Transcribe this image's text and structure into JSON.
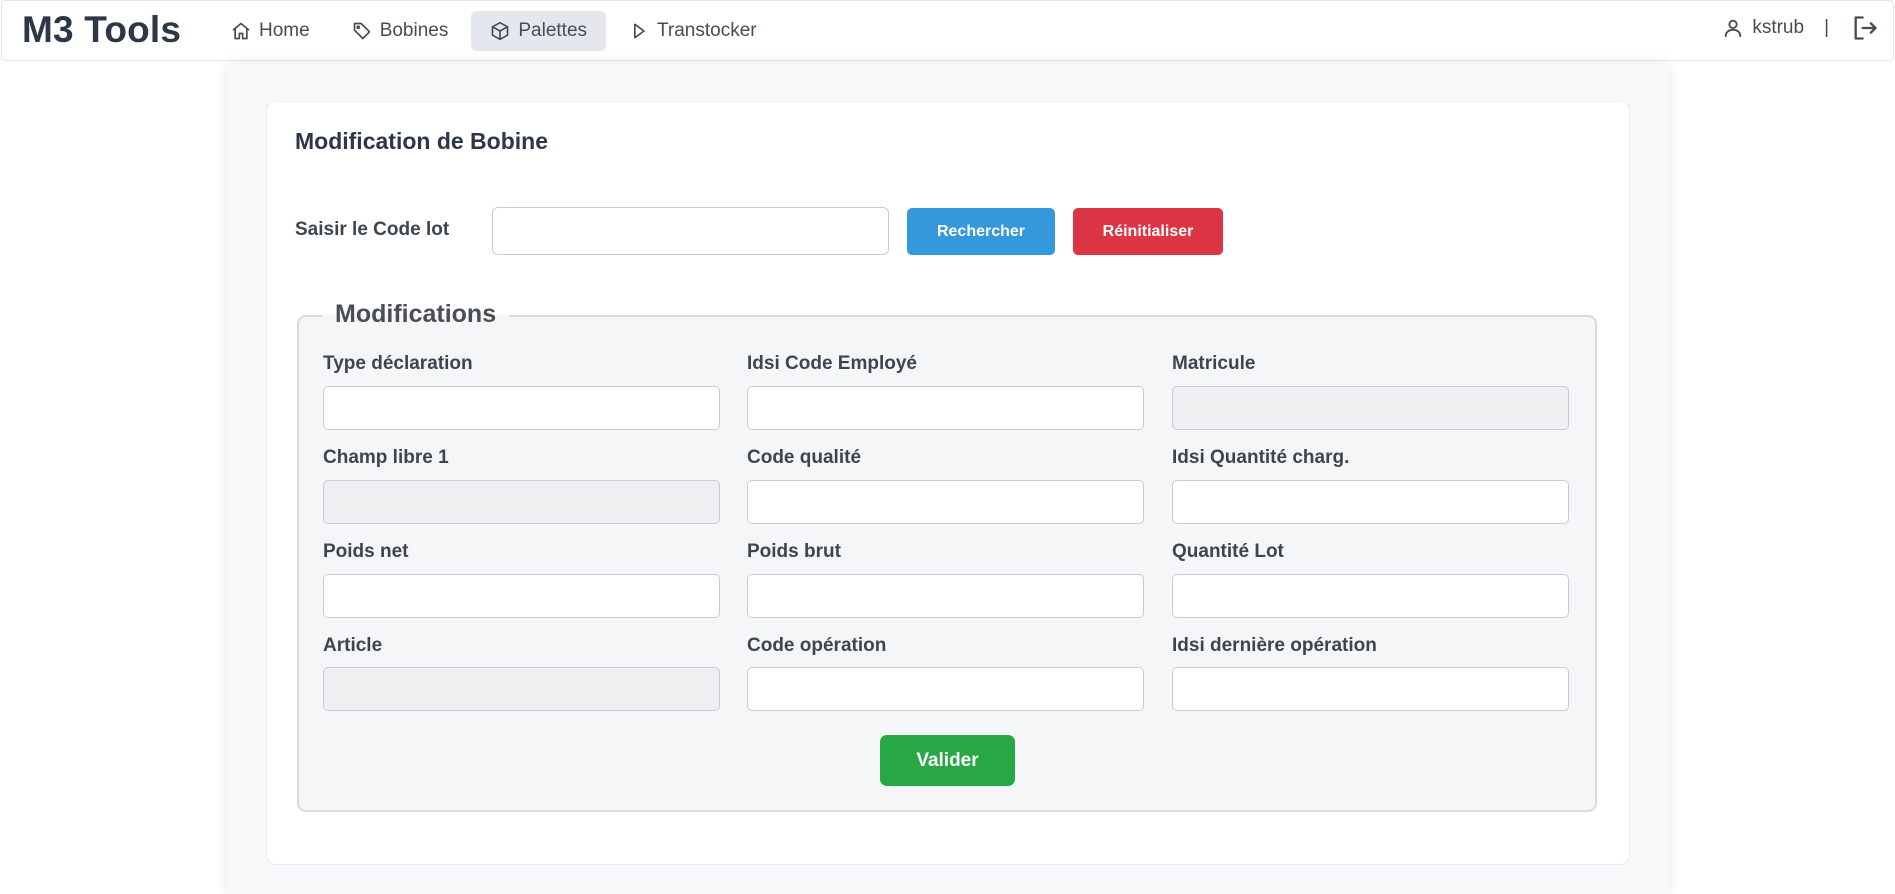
{
  "brand": "M3 Tools",
  "nav": {
    "items": [
      {
        "label": "Home",
        "icon": "home-icon"
      },
      {
        "label": "Bobines",
        "icon": "tag-icon"
      },
      {
        "label": "Palettes",
        "icon": "box-icon",
        "active": true
      },
      {
        "label": "Transtocker",
        "icon": "play-icon"
      }
    ],
    "username": "kstrub",
    "separator": "|"
  },
  "page": {
    "title": "Modification de Bobine",
    "search": {
      "label": "Saisir le Code lot",
      "value": "",
      "placeholder": "",
      "search_button": "Rechercher",
      "reset_button": "Réinitialiser"
    },
    "modifications": {
      "legend": "Modifications",
      "fields": [
        {
          "label": "Type déclaration",
          "value": "",
          "disabled": false
        },
        {
          "label": "Idsi Code Employé",
          "value": "",
          "disabled": false
        },
        {
          "label": "Matricule",
          "value": "",
          "disabled": true
        },
        {
          "label": "Champ libre 1",
          "value": "",
          "disabled": true
        },
        {
          "label": "Code qualité",
          "value": "",
          "disabled": false
        },
        {
          "label": "Idsi Quantité charg.",
          "value": "",
          "disabled": false
        },
        {
          "label": "Poids net",
          "value": "",
          "disabled": false
        },
        {
          "label": "Poids brut",
          "value": "",
          "disabled": false
        },
        {
          "label": "Quantité Lot",
          "value": "",
          "disabled": false
        },
        {
          "label": "Article",
          "value": "",
          "disabled": true
        },
        {
          "label": "Code opération",
          "value": "",
          "disabled": false
        },
        {
          "label": "Idsi dernière opération",
          "value": "",
          "disabled": false
        }
      ],
      "submit_button": "Valider"
    }
  },
  "colors": {
    "primary": "#3498db",
    "danger": "#dc3545",
    "success": "#28a745",
    "nav_active_bg": "#e4e8ee"
  }
}
